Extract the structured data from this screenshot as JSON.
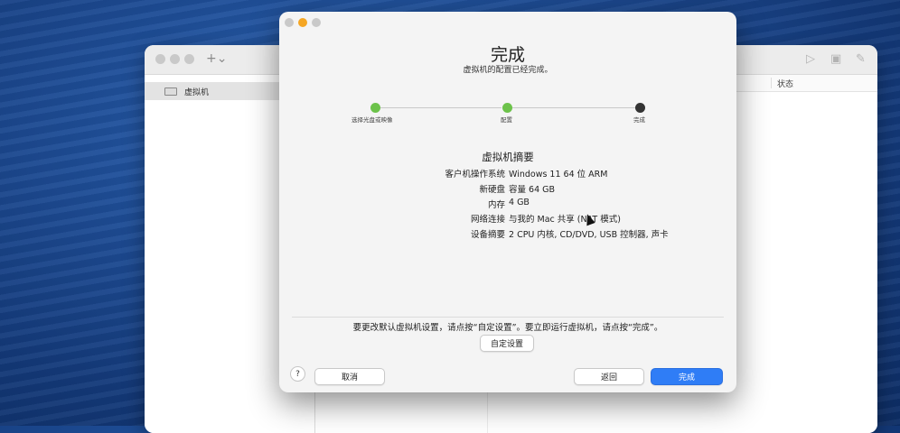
{
  "back_window": {
    "add_button": "+⌄",
    "sidebar_item": "虚拟机",
    "status_header": "状态"
  },
  "dialog": {
    "title": "完成",
    "subtitle": "虚拟机的配置已经完成。",
    "steps": [
      {
        "label": "选择光盘或映像",
        "state": "done"
      },
      {
        "label": "配置",
        "state": "done"
      },
      {
        "label": "完成",
        "state": "current"
      }
    ],
    "summary": {
      "title": "虚拟机摘要",
      "rows": [
        {
          "label": "客户机操作系统",
          "value": "Windows 11 64 位 ARM"
        },
        {
          "label": "新硬盘",
          "value": "容量 64 GB"
        },
        {
          "label": "内存",
          "value": "4 GB"
        },
        {
          "label": "网络连接",
          "value": "与我的 Mac 共享 (NAT 模式)"
        },
        {
          "label": "设备摘要",
          "value": "2 CPU 内核, CD/DVD, USB 控制器, 声卡"
        }
      ]
    },
    "notice": "要更改默认虚拟机设置，请点按“自定设置”。要立即运行虚拟机，请点按“完成”。",
    "buttons": {
      "customize": "自定设置",
      "help": "?",
      "cancel": "取消",
      "back": "返回",
      "finish": "完成"
    }
  },
  "colors": {
    "step_done": "#6cc24a",
    "step_current": "#333333",
    "primary_button": "#2f7df6",
    "close": "#c9c9c9",
    "minimize": "#f5a623",
    "zoom": "#c9c9c9"
  }
}
